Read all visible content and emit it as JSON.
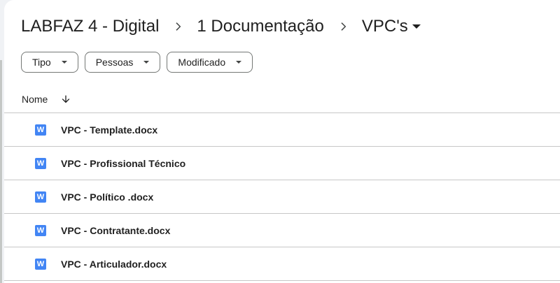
{
  "breadcrumb": {
    "items": [
      "LABFAZ 4 - Digital",
      "1 Documentação"
    ],
    "current": "VPC's"
  },
  "filters": [
    {
      "label": "Tipo"
    },
    {
      "label": "Pessoas"
    },
    {
      "label": "Modificado"
    }
  ],
  "list": {
    "column_name": "Nome",
    "sort_direction": "descending-arrow-icon",
    "files": [
      {
        "name": "VPC - Template.docx",
        "icon": "word-doc-icon",
        "icon_letter": "W"
      },
      {
        "name": "VPC - Profissional Técnico",
        "icon": "word-doc-icon",
        "icon_letter": "W"
      },
      {
        "name": "VPC - Político .docx",
        "icon": "word-doc-icon",
        "icon_letter": "W"
      },
      {
        "name": "VPC - Contratante.docx",
        "icon": "word-doc-icon",
        "icon_letter": "W"
      },
      {
        "name": "VPC - Articulador.docx",
        "icon": "word-doc-icon",
        "icon_letter": "W"
      }
    ]
  },
  "colors": {
    "word_blue": "#4285f4",
    "text": "#1f1f1f",
    "divider": "#c7c7c7"
  }
}
